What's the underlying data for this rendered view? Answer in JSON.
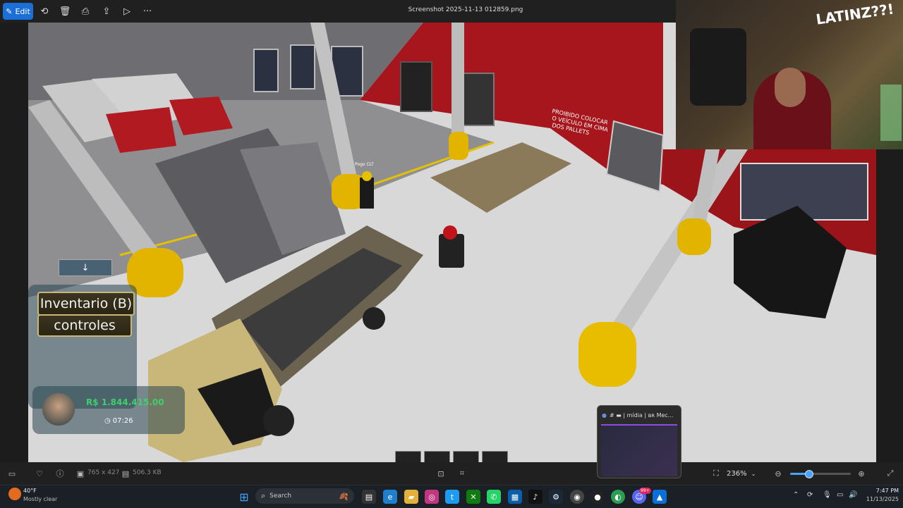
{
  "toolbar": {
    "edit_label": "Edit",
    "file_title": "Screenshot 2025-11-13 012859.png"
  },
  "game": {
    "sign_text": "PROIBIDO COLOCAR O VEÍCULO EM CIMA DOS PALLETS",
    "nametag": "Pogo CLT",
    "inventory_label": "Inventario (B)",
    "controls_label": "controles",
    "money": "R$ 1.844.415.00",
    "clock": "07:26"
  },
  "webcam": {
    "wall_text": "LATINZ??!"
  },
  "infobar": {
    "dimensions": "765 x 427",
    "file_size": "506.3 KB",
    "zoom": "236%",
    "zoom_level": 0.3
  },
  "popup": {
    "title": "# ▬ | mídia | ʙʀ Mec..."
  },
  "taskbar": {
    "temperature": "40°F",
    "weather": "Mostly clear",
    "search_placeholder": "Search",
    "time": "7:47 PM",
    "date": "11/13/2025",
    "badge_notifications": "99+"
  }
}
